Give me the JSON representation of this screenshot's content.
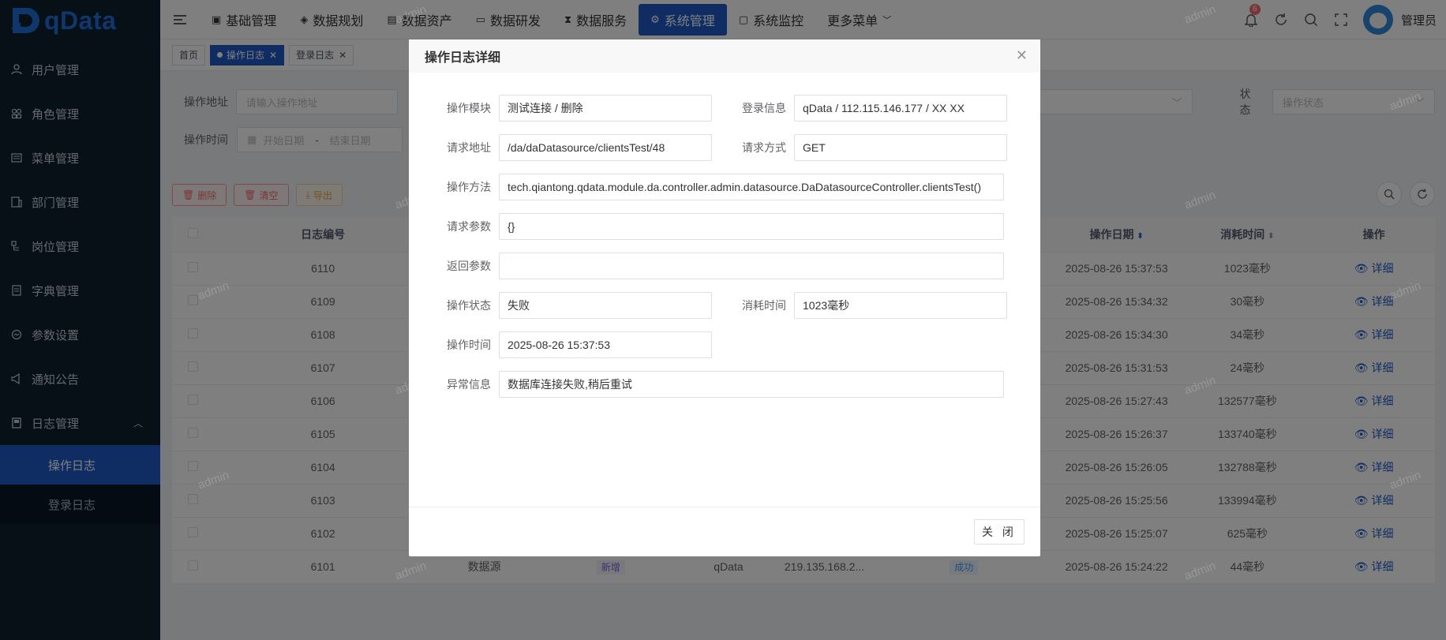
{
  "app": {
    "logo_text": "qData"
  },
  "sidebar": {
    "items": [
      {
        "label": "用户管理",
        "icon": "user-icon"
      },
      {
        "label": "角色管理",
        "icon": "role-icon"
      },
      {
        "label": "菜单管理",
        "icon": "menu-icon"
      },
      {
        "label": "部门管理",
        "icon": "dept-icon"
      },
      {
        "label": "岗位管理",
        "icon": "post-icon"
      },
      {
        "label": "字典管理",
        "icon": "dict-icon"
      },
      {
        "label": "参数设置",
        "icon": "param-icon"
      },
      {
        "label": "通知公告",
        "icon": "notice-icon"
      },
      {
        "label": "日志管理",
        "icon": "log-icon"
      }
    ],
    "sub_items": [
      {
        "label": "操作日志",
        "active": true
      },
      {
        "label": "登录日志",
        "active": false
      }
    ]
  },
  "topnav": {
    "items": [
      {
        "label": "基础管理"
      },
      {
        "label": "数据规划"
      },
      {
        "label": "数据资产"
      },
      {
        "label": "数据研发"
      },
      {
        "label": "数据服务"
      },
      {
        "label": "系统管理",
        "active": true
      },
      {
        "label": "系统监控"
      },
      {
        "label": "更多菜单"
      }
    ],
    "badge_count": "6",
    "user_name": "管理员"
  },
  "tags": [
    {
      "label": "首页"
    },
    {
      "label": "操作日志",
      "active": true
    },
    {
      "label": "登录日志"
    }
  ],
  "filters": {
    "addr_label": "操作地址",
    "addr_placeholder": "请输入操作地址",
    "status_label": "状态",
    "status_placeholder": "操作状态",
    "time_label": "操作时间",
    "start_placeholder": "开始日期",
    "sep": "-",
    "end_placeholder": "结束日期"
  },
  "actions": {
    "delete": "删除",
    "clear": "清空",
    "export": "导出"
  },
  "table": {
    "headers": {
      "id": "日志编号",
      "date": "操作日期",
      "cost": "消耗时间",
      "op": "操作"
    },
    "detail_label": "详细",
    "rows": [
      {
        "id": "6110",
        "date": "2025-08-26 15:37:53",
        "cost": "1023毫秒"
      },
      {
        "id": "6109",
        "date": "2025-08-26 15:34:32",
        "cost": "30毫秒"
      },
      {
        "id": "6108",
        "date": "2025-08-26 15:34:30",
        "cost": "34毫秒"
      },
      {
        "id": "6107",
        "date": "2025-08-26 15:31:53",
        "cost": "24毫秒"
      },
      {
        "id": "6106",
        "date": "2025-08-26 15:27:43",
        "cost": "132577毫秒"
      },
      {
        "id": "6105",
        "date": "2025-08-26 15:26:37",
        "cost": "133740毫秒"
      },
      {
        "id": "6104",
        "date": "2025-08-26 15:26:05",
        "cost": "132788毫秒"
      },
      {
        "id": "6103",
        "date": "2025-08-26 15:25:56",
        "cost": "133994毫秒"
      },
      {
        "id": "6102",
        "date": "2025-08-26 15:25:07",
        "cost": "625毫秒"
      },
      {
        "id": "6101",
        "date": "2025-08-26 15:24:22",
        "cost": "44毫秒",
        "module": "数据源",
        "type": "新增",
        "user": "qData",
        "ip": "219.135.168.2...",
        "status": "成功"
      }
    ]
  },
  "dialog": {
    "title": "操作日志详细",
    "fields": {
      "module_label": "操作模块",
      "module_value": "测试连接 / 删除",
      "login_label": "登录信息",
      "login_value": "qData / 112.115.146.177 / XX XX",
      "url_label": "请求地址",
      "url_value": "/da/daDatasource/clientsTest/48",
      "method_label": "请求方式",
      "method_value": "GET",
      "func_label": "操作方法",
      "func_value": "tech.qiantong.qdata.module.da.controller.admin.datasource.DaDatasourceController.clientsTest()",
      "param_label": "请求参数",
      "param_value": "{}",
      "result_label": "返回参数",
      "result_value": "",
      "status_label": "操作状态",
      "status_value": "失败",
      "cost_label": "消耗时间",
      "cost_value": "1023毫秒",
      "time_label": "操作时间",
      "time_value": "2025-08-26 15:37:53",
      "error_label": "异常信息",
      "error_value": "数据库连接失败,稍后重试"
    },
    "close_label": "关 闭"
  },
  "watermark": "admin",
  "colors": {
    "primary": "#1e5bc6",
    "sidebar": "#0f1e2f",
    "danger": "#f56c6c",
    "warning": "#e6a23c"
  }
}
